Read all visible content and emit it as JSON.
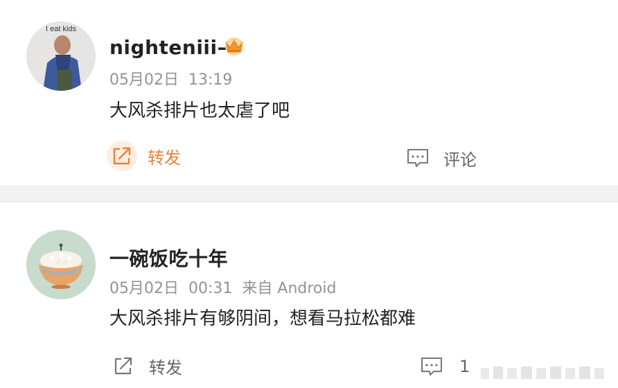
{
  "posts": [
    {
      "username": "nighteniii–",
      "avatar_text": "I eat kids",
      "date": "05月02日",
      "time": "13:19",
      "source": "",
      "content": "大风杀排片也太虐了吧",
      "repost_label": "转发",
      "comment_label": "评论",
      "repost_active": true
    },
    {
      "username": "一碗饭吃十年",
      "date": "05月02日",
      "time": "00:31",
      "source": "来自 Android",
      "content": "大风杀排片有够阴间，想看马拉松都难",
      "repost_label": "转发",
      "comment_count": "1"
    }
  ],
  "colors": {
    "accent_orange": "#e8823a",
    "text_primary": "#222222",
    "text_meta": "#939393",
    "divider": "#f2f2f2"
  },
  "icons": {
    "badge": "crown-badge-icon",
    "repost": "share-arrow-icon",
    "comment": "comment-bubble-icon"
  }
}
